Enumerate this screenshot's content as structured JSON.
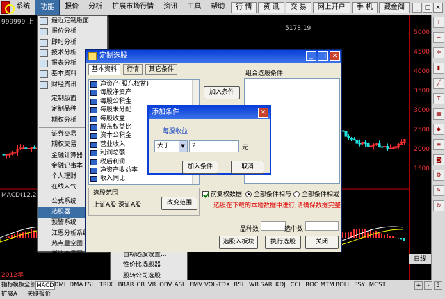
{
  "menubar": {
    "items": [
      "系统",
      "功能",
      "报价",
      "分析",
      "扩展市场行情",
      "资讯",
      "工具",
      "帮助"
    ],
    "right_buttons": [
      "行 情",
      "资 讯",
      "交 易",
      "网上开户",
      "手 机",
      "藏金阁"
    ],
    "window_controls": [
      "_",
      "□",
      "×"
    ]
  },
  "chart": {
    "code_label": "999999 上",
    "peak_label": "5178.19",
    "year_label": "2012年",
    "day_label": "日线",
    "yticks": [
      "5000",
      "4500",
      "4000",
      "3500",
      "3000",
      "2500",
      "2000",
      "1500"
    ],
    "indicator_label": "MACD(12,2",
    "colors": {
      "up": "#ff3030",
      "down": "#20e0e0",
      "axis": "#c00000",
      "macd_line1": "#ffffff",
      "macd_line2": "#ffff00"
    }
  },
  "dropmenu": {
    "items": [
      {
        "label": "最近定制版面",
        "icon": "layout-icon"
      },
      {
        "label": "报价分析",
        "icon": "grid-icon"
      },
      {
        "label": "即时分析",
        "icon": "line-chart-icon"
      },
      {
        "label": "技术分析",
        "icon": "candle-icon"
      },
      {
        "label": "报表分析",
        "icon": "report-icon"
      },
      {
        "label": "基本资料",
        "icon": "info-icon"
      },
      {
        "label": "财经资讯",
        "icon": "news-icon"
      },
      {
        "sep": true
      },
      {
        "label": "定制版面"
      },
      {
        "label": "定制品种"
      },
      {
        "label": "期权分析"
      },
      {
        "sep": true
      },
      {
        "label": "证券交易"
      },
      {
        "label": "期权交易"
      },
      {
        "label": "金融计算器"
      },
      {
        "label": "金融记事本"
      },
      {
        "label": "个人理财"
      },
      {
        "label": "在线人气"
      },
      {
        "sep": true
      },
      {
        "label": "公式系统"
      },
      {
        "label": "选股器",
        "highlight": true
      },
      {
        "label": "预警系统"
      },
      {
        "label": "江恩分析系统"
      },
      {
        "label": "热点星空图"
      },
      {
        "label": "板块全景图"
      }
    ]
  },
  "submenu": {
    "items": [
      "自动选股设置...",
      "性价比选股器",
      "股转公司选股"
    ]
  },
  "custom_dialog": {
    "title": "定制选股",
    "tabs": [
      "基本资料",
      "行情",
      "其它条件"
    ],
    "list_items": [
      "净资产(股东权益)",
      "每股净资产",
      "每股公积金",
      "每股未分配",
      "每股收益",
      "股东权益比",
      "资本公积金",
      "营业收入",
      "利润总额",
      "税后利润",
      "净资产收益率",
      "收入同比"
    ],
    "add_condition_button": "加入条件",
    "combo_header": "组合选股条件",
    "range_title": "选股范围",
    "range_value": "上证A股 深证A股",
    "change_range_button": "改变范围",
    "checkbox_label": "前复权数据",
    "checkbox_checked": true,
    "radio_and": "全部条件相与",
    "radio_or": "全部条件相或",
    "radio_selected": "and",
    "warning": "选股在下载的本地数据中进行,请确保数据完整",
    "count_label": "品种数",
    "selected_label": "选中数",
    "btn_to_block": "选股入板块",
    "btn_execute": "执行选股",
    "btn_close": "关闭",
    "colors": {
      "warning": "#e00000"
    }
  },
  "add_dialog": {
    "title": "添加条件",
    "field_label": "每股收益",
    "operator": "大于",
    "value": "2",
    "unit": "元",
    "add_button": "加入条件",
    "cancel_button": "取消"
  },
  "bottom": {
    "indicator_tabs": [
      "指标",
      "模板",
      "全部",
      "MACD",
      "DMI",
      "DMA",
      "FSL",
      "TRIX",
      "BRAR",
      "CR",
      "VR",
      "OBV",
      "ASI",
      "EMV",
      "VOL-TDX",
      "RSI",
      "WR",
      "SAR",
      "KDJ",
      "CCI",
      "ROC",
      "MTM",
      "BOLL",
      "PSY",
      "MCST"
    ],
    "status_tabs": [
      "扩展A",
      "关联报价"
    ],
    "right_controls": [
      "+",
      "-",
      "5"
    ]
  }
}
